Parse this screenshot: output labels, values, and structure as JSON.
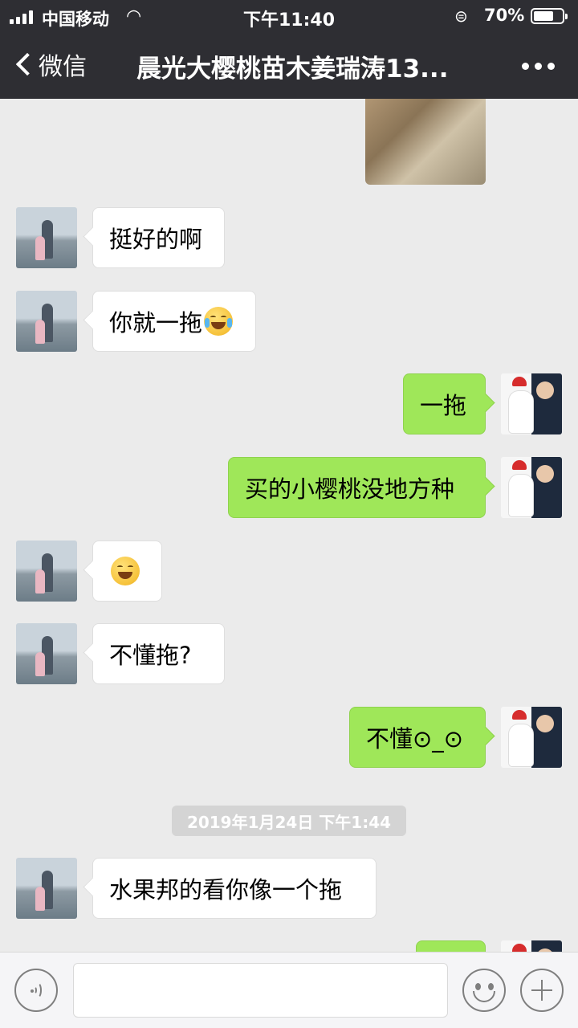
{
  "status_bar": {
    "carrier": "中国移动",
    "time": "下午11:40",
    "battery_percent": "70%",
    "battery_level": 0.7
  },
  "nav": {
    "back_label": "微信",
    "title": "晨光大樱桃苗木姜瑞涛13..."
  },
  "messages": [
    {
      "side": "in",
      "text": "挺好的啊"
    },
    {
      "side": "in",
      "text": "你就一拖",
      "emoji": "crying-laughing-emoji"
    },
    {
      "side": "out",
      "text": "一拖"
    },
    {
      "side": "out",
      "text": "买的小樱桃没地方种"
    },
    {
      "side": "in",
      "emoji": "grinning-emoji"
    },
    {
      "side": "in",
      "text": "不懂拖?"
    },
    {
      "side": "out",
      "text": "不懂⊙_⊙"
    },
    {
      "side": "in",
      "text": "水果邦的看你像一个拖"
    }
  ],
  "timestamp": "2019年1月24日 下午1:44",
  "colors": {
    "header_bg": "#2e2e33",
    "chat_bg": "#ebebeb",
    "outgoing_bubble": "#9fe759",
    "incoming_bubble": "#ffffff"
  }
}
